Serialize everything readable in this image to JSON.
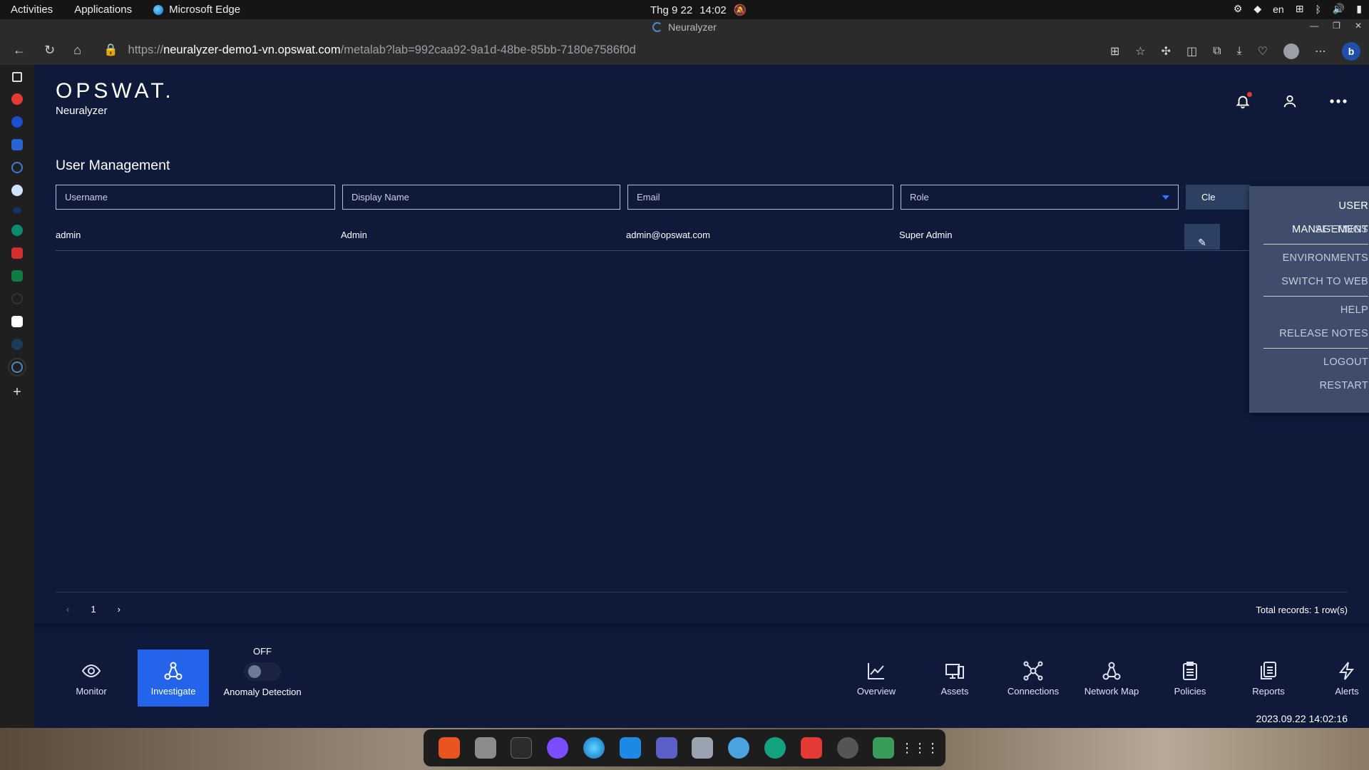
{
  "system": {
    "activities": "Activities",
    "applications": "Applications",
    "browser_name": "Microsoft Edge",
    "date": "Thg 9 22",
    "time": "14:02",
    "lang": "en"
  },
  "browser": {
    "tab_title": "Neuralyzer",
    "url_scheme": "https://",
    "url_host": "neuralyzer-demo1-vn.opswat.com",
    "url_path": "/metalab?lab=992caa92-9a1d-48be-85bb-7180e7586f0d"
  },
  "app": {
    "brand": "OPSWAT.",
    "product": "Neuralyzer",
    "page_title": "User Management"
  },
  "filters": {
    "username_placeholder": "Username",
    "display_name_placeholder": "Display Name",
    "email_placeholder": "Email",
    "role_value": "Role",
    "clear_label": "Cle"
  },
  "table": {
    "rows": [
      {
        "username": "admin",
        "display_name": "Admin",
        "email": "admin@opswat.com",
        "role": "Super Admin"
      }
    ]
  },
  "pager": {
    "page": "1",
    "total": "Total records: 1 row(s)"
  },
  "menu": {
    "items": [
      "USER MANAGEMENT",
      "SETTINGS",
      "ENVIRONMENTS",
      "SWITCH TO WEB",
      "HELP",
      "RELEASE NOTES",
      "LOGOUT",
      "RESTART"
    ]
  },
  "bottom_nav": {
    "monitor": "Monitor",
    "investigate": "Investigate",
    "anomaly_state": "OFF",
    "anomaly_label": "Anomaly Detection",
    "overview": "Overview",
    "assets": "Assets",
    "connections": "Connections",
    "network_map": "Network Map",
    "policies": "Policies",
    "reports": "Reports",
    "alerts": "Alerts",
    "timestamp": "2023.09.22 14:02:16"
  },
  "colors": {
    "background": "#0f1a3b",
    "accent": "#2464ea",
    "menu": "#3f4c6b"
  }
}
